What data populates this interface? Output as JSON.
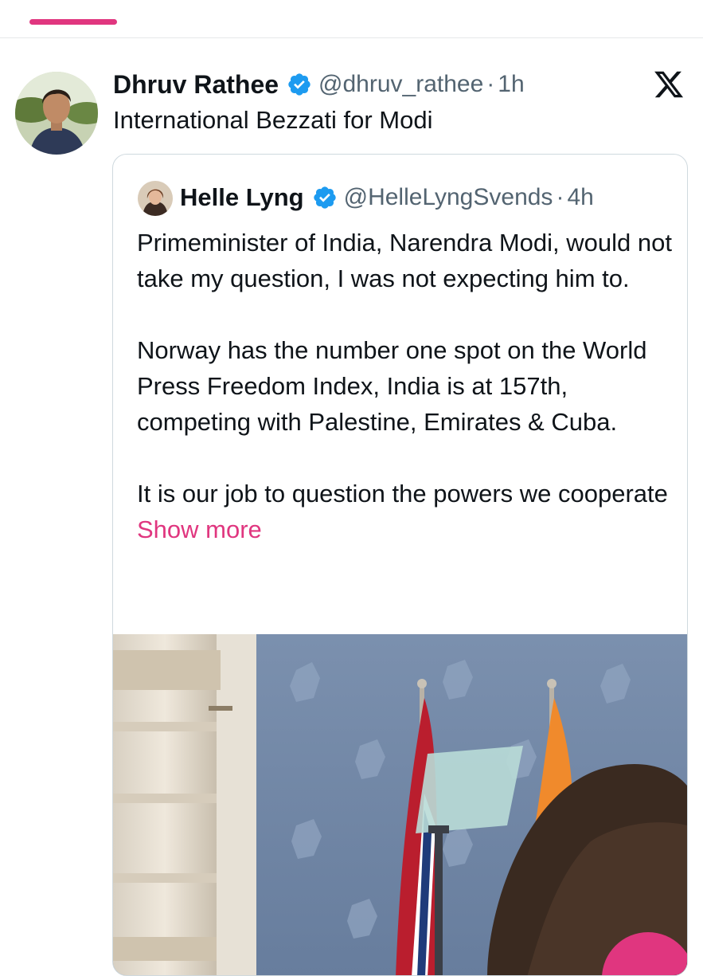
{
  "colors": {
    "accent": "#e0367f",
    "verified": "#1d9bf0",
    "text": "#0f1419",
    "secondary": "#536471",
    "border": "#cfd9de"
  },
  "tweet": {
    "author_name": "Dhruv Rathee",
    "author_handle": "@dhruv_rathee",
    "separator": "·",
    "time": "1h",
    "text": "International Bezzati for Modi",
    "icons": {
      "avatar": "avatar",
      "verified": "verified-badge-icon",
      "platform": "x-logo-icon"
    }
  },
  "quote": {
    "author_name": "Helle Lyng",
    "author_handle": "@HelleLyngSvends",
    "separator": "·",
    "time": "4h",
    "text": "Primeminister of India, Narendra Modi, would not take my question, I was not expecting him to.\n\nNorway has the number one spot on the World Press Freedom Index, India is at 157th, competing with Palestine, Emirates & Cuba.\n\nIt is our job to question the powers we cooperate ",
    "show_more": "Show more",
    "media": "video-thumbnail-press-conference"
  }
}
